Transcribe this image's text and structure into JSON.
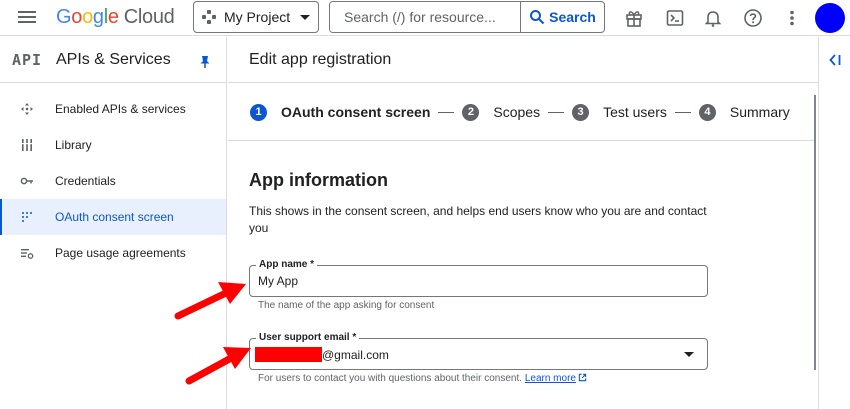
{
  "topbar": {
    "logo_letters": [
      "G",
      "o",
      "o",
      "g",
      "l",
      "e"
    ],
    "logo_suffix": "Cloud",
    "project_label": "My Project",
    "search_placeholder": "Search (/) for resource...",
    "search_button": "Search",
    "icons": [
      "gift-icon",
      "terminal-icon",
      "bell-icon",
      "help-icon",
      "more-vert-icon"
    ],
    "avatar_color": "#0000ff"
  },
  "sidebar": {
    "api_badge": "API",
    "title": "APIs & Services",
    "items": [
      {
        "label": "Enabled APIs & services",
        "icon": "enabled-apis-icon",
        "active": false
      },
      {
        "label": "Library",
        "icon": "library-icon",
        "active": false
      },
      {
        "label": "Credentials",
        "icon": "key-icon",
        "active": false
      },
      {
        "label": "OAuth consent screen",
        "icon": "oauth-icon",
        "active": true
      },
      {
        "label": "Page usage agreements",
        "icon": "settings-list-icon",
        "active": false
      }
    ]
  },
  "main": {
    "title": "Edit app registration",
    "steps": [
      {
        "num": "1",
        "label": "OAuth consent screen",
        "active": true
      },
      {
        "num": "2",
        "label": "Scopes",
        "active": false
      },
      {
        "num": "3",
        "label": "Test users",
        "active": false
      },
      {
        "num": "4",
        "label": "Summary",
        "active": false
      }
    ],
    "section_title": "App information",
    "section_desc": "This shows in the consent screen, and helps end users know who you are and contact you",
    "app_name": {
      "label": "App name *",
      "value": "My App",
      "hint": "The name of the app asking for consent"
    },
    "support_email": {
      "label": "User support email *",
      "value_suffix": "@gmail.com",
      "hint": "For users to contact you with questions about their consent.",
      "learn_more": "Learn more"
    }
  },
  "colors": {
    "accent": "#0b57d0",
    "active_bg": "#e8f0fe",
    "arrow": "#ff0000",
    "redaction": "#ff0000"
  }
}
